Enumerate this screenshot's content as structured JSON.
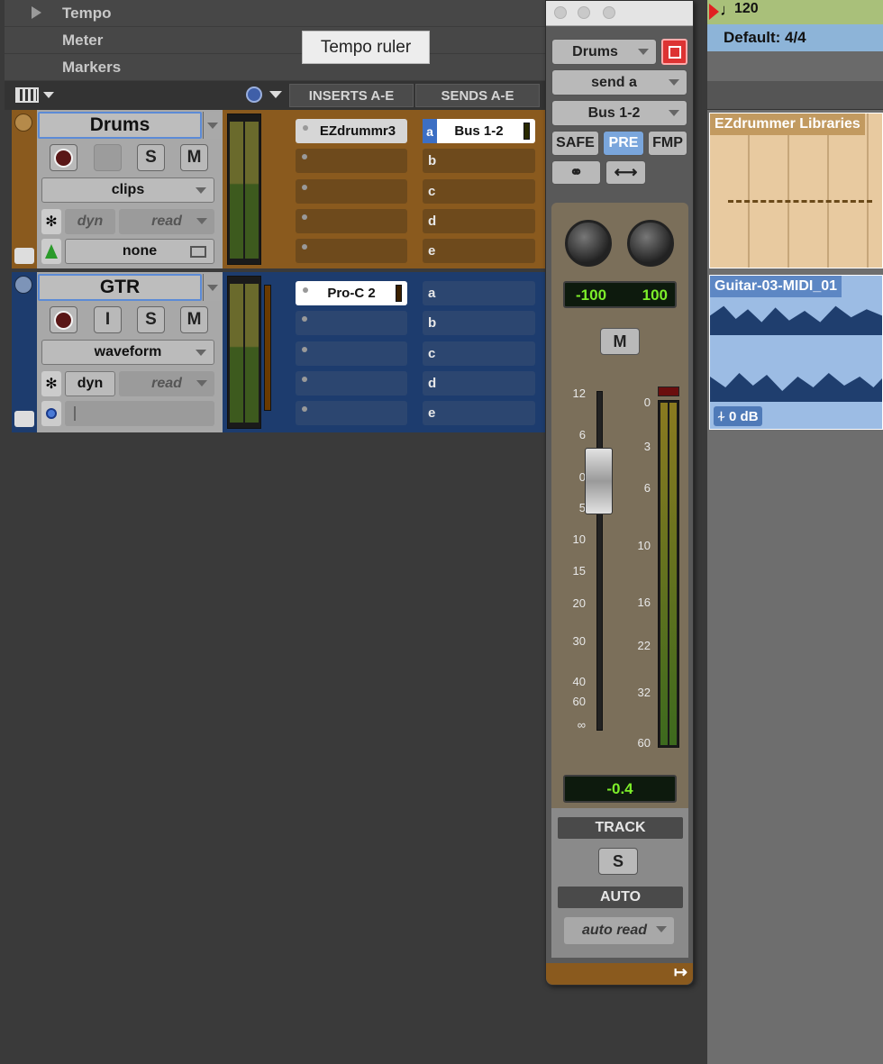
{
  "rulers": {
    "tempo": "Tempo",
    "meter": "Meter",
    "markers": "Markers"
  },
  "tooltip": "Tempo ruler",
  "columns": {
    "inserts": "INSERTS A-E",
    "sends": "SENDS A-E"
  },
  "tracks": [
    {
      "name": "Drums",
      "color": "#8a5a1e",
      "view": "clips",
      "auto_dyn": "dyn",
      "auto_mode": "read",
      "input_button": "",
      "solo": "S",
      "mute": "M",
      "output": "none",
      "inserts": [
        "EZdrummr3",
        "",
        "",
        "",
        ""
      ],
      "sends": [
        "Bus 1-2",
        "b",
        "c",
        "d",
        "e"
      ],
      "send_a_letter": "a"
    },
    {
      "name": "GTR",
      "color": "#1d3c6e",
      "view": "waveform",
      "auto_dyn": "dyn",
      "auto_mode": "read",
      "input_button": "I",
      "solo": "S",
      "mute": "M",
      "inserts": [
        "Pro-C 2",
        "",
        "",
        "",
        ""
      ],
      "sends": [
        "a",
        "b",
        "c",
        "d",
        "e"
      ]
    }
  ],
  "timeline": {
    "tempo_value": "120",
    "meter_value": "Default: 4/4",
    "clip_drums": "EZdrummer Libraries",
    "clip_gtr": "Guitar-03-MIDI_01",
    "clip_gain": "0 dB"
  },
  "mixer": {
    "track_name": "Drums",
    "send_select": "send a",
    "bus": "Bus 1-2",
    "safe": "SAFE",
    "pre": "PRE",
    "fmp": "FMP",
    "pan_left": "-100",
    "pan_right": "100",
    "mute": "M",
    "fader_scale": [
      "12",
      "6",
      "0",
      "5",
      "10",
      "15",
      "20",
      "30",
      "40",
      "60",
      "∞"
    ],
    "meter_scale": [
      "0",
      "3",
      "6",
      "10",
      "16",
      "22",
      "32",
      "60"
    ],
    "volume": "-0.4",
    "track_label": "TRACK",
    "solo": "S",
    "auto_label": "AUTO",
    "auto_mode": "auto read"
  }
}
